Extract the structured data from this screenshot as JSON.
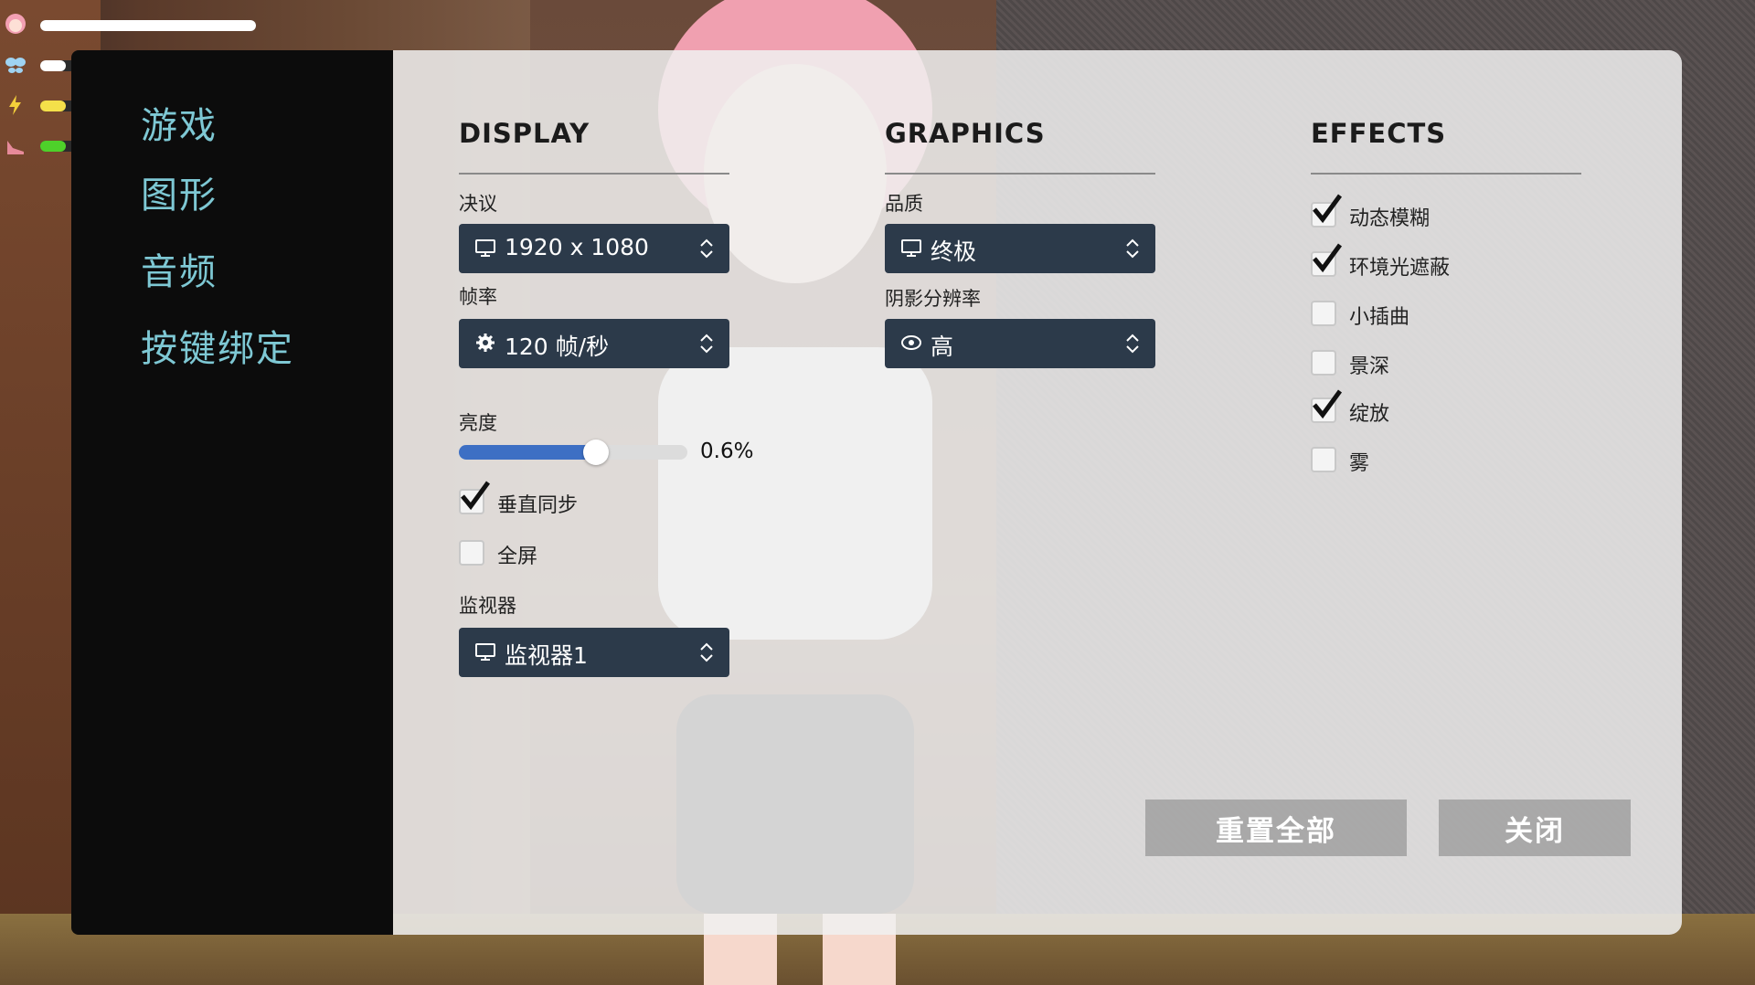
{
  "hud": {
    "bars": [
      {
        "icon": "avatar-icon",
        "color": "#ffffff",
        "level": 1.0
      },
      {
        "icon": "wings-icon",
        "color": "#ffffff",
        "level": 0.12
      },
      {
        "icon": "lightning-icon",
        "color": "#f4e04a",
        "level": 0.12
      },
      {
        "icon": "shoe-icon",
        "color": "#4ed12a",
        "level": 0.12
      }
    ]
  },
  "sidebar": {
    "items": [
      {
        "label": "游戏"
      },
      {
        "label": "图形"
      },
      {
        "label": "音频"
      },
      {
        "label": "按键绑定"
      }
    ]
  },
  "display": {
    "title": "DISPLAY",
    "resolution_label": "决议",
    "resolution_value": "1920 x 1080",
    "framerate_label": "帧率",
    "framerate_value": "120 帧/秒",
    "brightness_label": "亮度",
    "brightness_value": "0.6%",
    "brightness_level": 0.6,
    "vsync_label": "垂直同步",
    "vsync_checked": true,
    "fullscreen_label": "全屏",
    "fullscreen_checked": false,
    "monitor_label": "监视器",
    "monitor_value": "监视器1"
  },
  "graphics": {
    "title": "GRAPHICS",
    "quality_label": "品质",
    "quality_value": "终极",
    "shadow_label": "阴影分辨率",
    "shadow_value": "高"
  },
  "effects": {
    "title": "EFFECTS",
    "items": [
      {
        "label": "动态模糊",
        "checked": true
      },
      {
        "label": "环境光遮蔽",
        "checked": true
      },
      {
        "label": "小插曲",
        "checked": false
      },
      {
        "label": "景深",
        "checked": false
      },
      {
        "label": "绽放",
        "checked": true
      },
      {
        "label": "雾",
        "checked": false
      }
    ]
  },
  "buttons": {
    "reset_label": "重置全部",
    "close_label": "关闭"
  },
  "colors": {
    "accent": "#7ec8d4",
    "dropdown_bg": "#2c3a4a",
    "slider_fill": "#3d6fc4"
  }
}
